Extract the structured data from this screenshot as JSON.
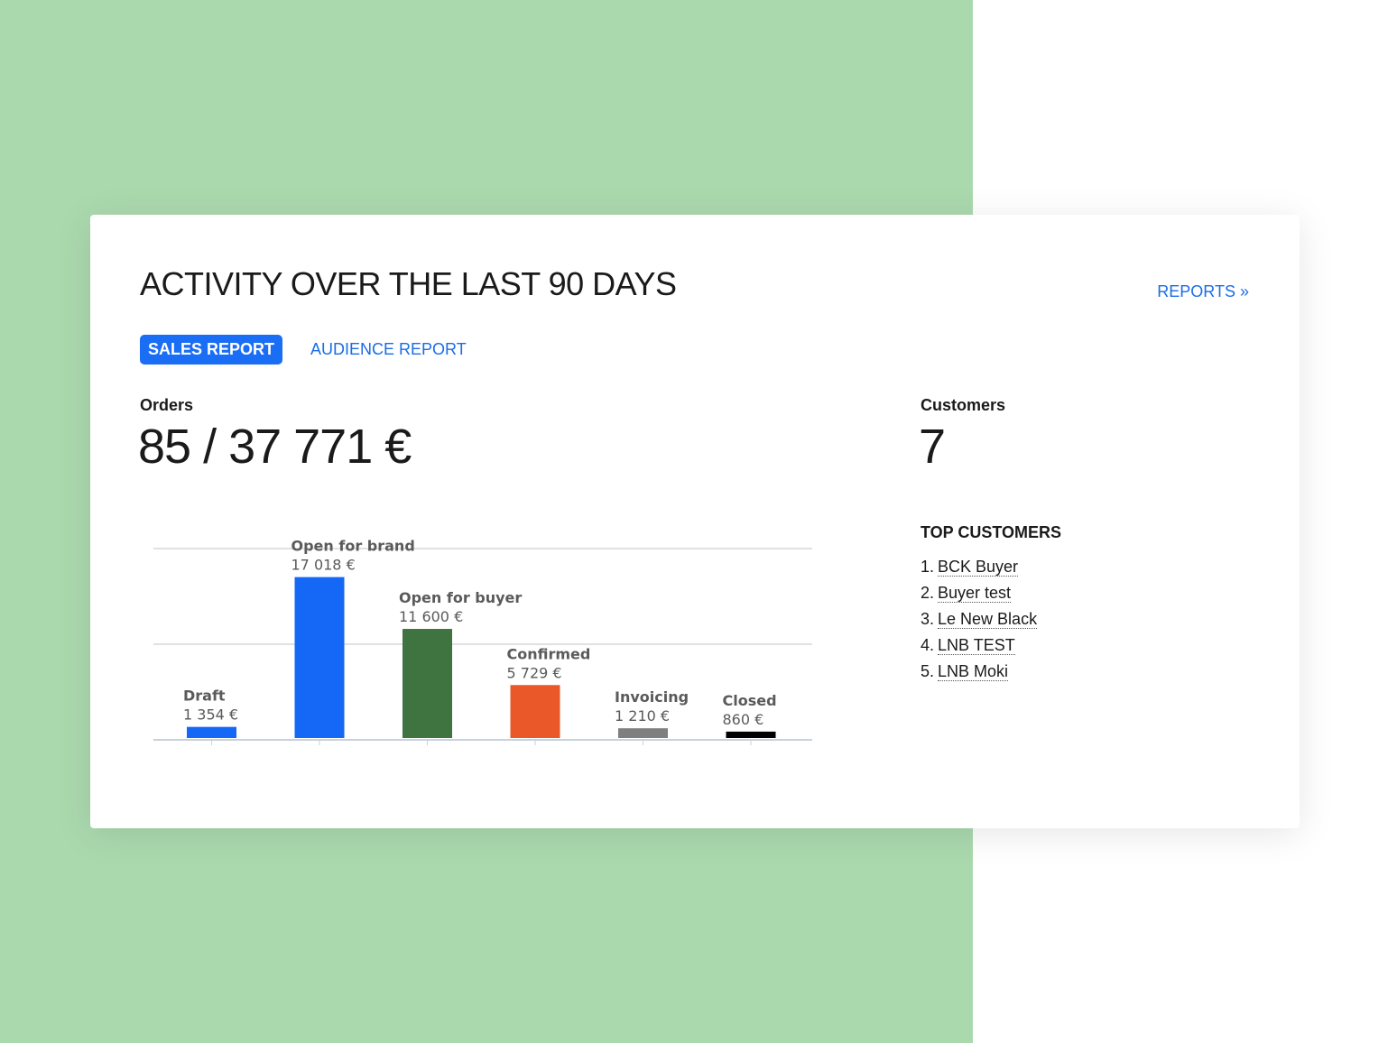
{
  "header": {
    "title": "ACTIVITY OVER THE LAST 90 DAYS",
    "reports_link": "REPORTS »"
  },
  "tabs": [
    {
      "label": "SALES REPORT",
      "active": true
    },
    {
      "label": "AUDIENCE REPORT",
      "active": false
    }
  ],
  "orders": {
    "label": "Orders",
    "value": "85 / 37 771 €"
  },
  "customers": {
    "label": "Customers",
    "value": "7"
  },
  "top_customers": {
    "title": "TOP CUSTOMERS",
    "items": [
      {
        "rank": "1.",
        "name": "BCK Buyer"
      },
      {
        "rank": "2.",
        "name": "Buyer test"
      },
      {
        "rank": "3.",
        "name": "Le New Black"
      },
      {
        "rank": "4.",
        "name": "LNB TEST"
      },
      {
        "rank": "5.",
        "name": "LNB Moki"
      }
    ]
  },
  "colors": {
    "accent": "#1a6ef5",
    "link": "#1a6de6",
    "background_panel": "#abd9ae"
  },
  "chart_data": {
    "type": "bar",
    "categories": [
      "Draft",
      "Open for brand",
      "Open for buyer",
      "Confirmed",
      "Invoicing",
      "Closed"
    ],
    "values": [
      1354,
      17018,
      11600,
      5729,
      1210,
      860
    ],
    "value_labels": [
      "1 354 €",
      "17 018 €",
      "11 600 €",
      "5 729 €",
      "1 210 €",
      "860 €"
    ],
    "colors": [
      "#1567f5",
      "#1567f5",
      "#3f7340",
      "#ea582a",
      "#7f7f7f",
      "#000000"
    ],
    "ylim": [
      0,
      20000
    ],
    "gridlines": [
      0,
      10000,
      20000
    ],
    "grid": true,
    "legend": "none"
  }
}
